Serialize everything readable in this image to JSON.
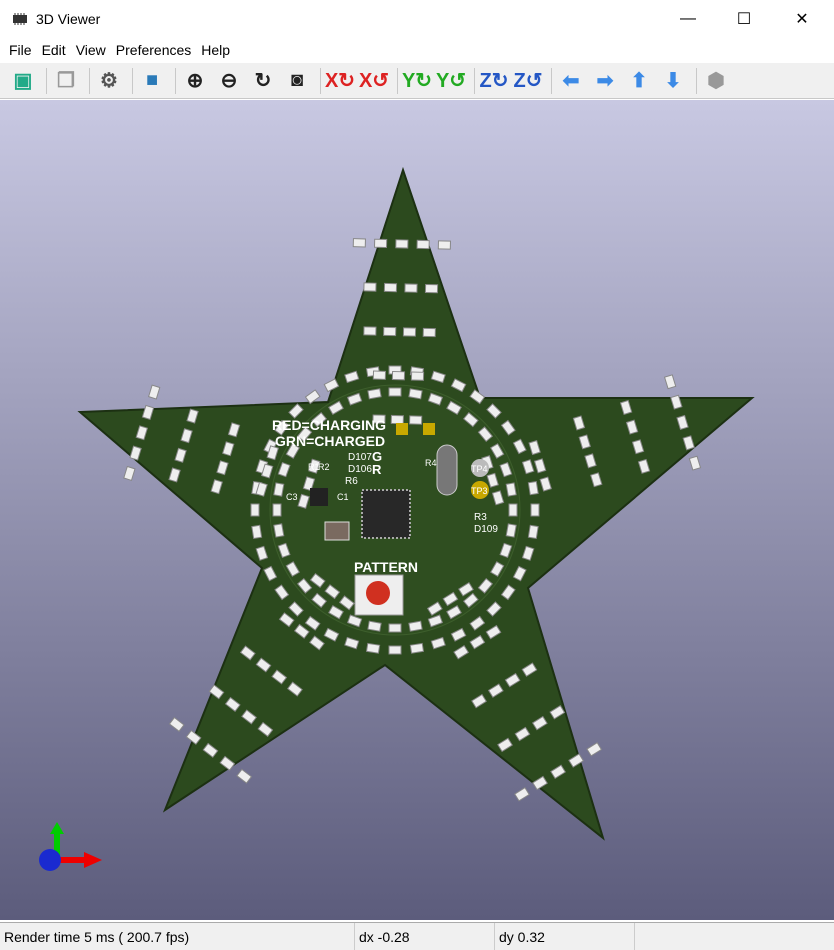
{
  "window": {
    "title": "3D Viewer",
    "minimize": "—",
    "maximize": "☐",
    "close": "✕"
  },
  "menu": [
    "File",
    "Edit",
    "View",
    "Preferences",
    "Help"
  ],
  "toolbar": [
    {
      "icon": "reload-board-icon"
    },
    {
      "icon": "copy-image-icon"
    },
    {
      "icon": "settings-icon"
    },
    {
      "icon": "raytracing-icon"
    },
    {
      "icon": "zoom-in-icon"
    },
    {
      "icon": "zoom-out-icon"
    },
    {
      "icon": "redraw-icon"
    },
    {
      "icon": "zoom-fit-icon"
    },
    {
      "icon": "rotate-x-cw-icon"
    },
    {
      "icon": "rotate-x-ccw-icon"
    },
    {
      "icon": "rotate-y-cw-icon"
    },
    {
      "icon": "rotate-y-ccw-icon"
    },
    {
      "icon": "rotate-z-cw-icon"
    },
    {
      "icon": "rotate-z-ccw-icon"
    },
    {
      "icon": "pan-left-icon"
    },
    {
      "icon": "pan-right-icon"
    },
    {
      "icon": "pan-up-icon"
    },
    {
      "icon": "pan-down-icon"
    },
    {
      "icon": "orthographic-toggle-icon"
    }
  ],
  "board": {
    "silk": {
      "red": "RED=CHARGING",
      "grn": "GRN=CHARGED",
      "pattern": "PATTERN",
      "d107": "D107",
      "g": "G",
      "d106": "D106",
      "r": "R",
      "r6": "R6",
      "r3": "R3",
      "d109": "D109",
      "tp3": "TP3",
      "tp4": "TP4",
      "r4": "R4",
      "r1": "R1",
      "r2": "R2",
      "c1": "C1",
      "c3": "C3"
    },
    "colors": {
      "pcb": "#2c4a1e",
      "silk": "#ffffff",
      "button": "#d03020",
      "pad": "#c8a800"
    }
  },
  "status": {
    "render": "Render time 5 ms ( 200.7 fps)",
    "dx": "dx -0.28",
    "dy": "dy 0.32"
  }
}
